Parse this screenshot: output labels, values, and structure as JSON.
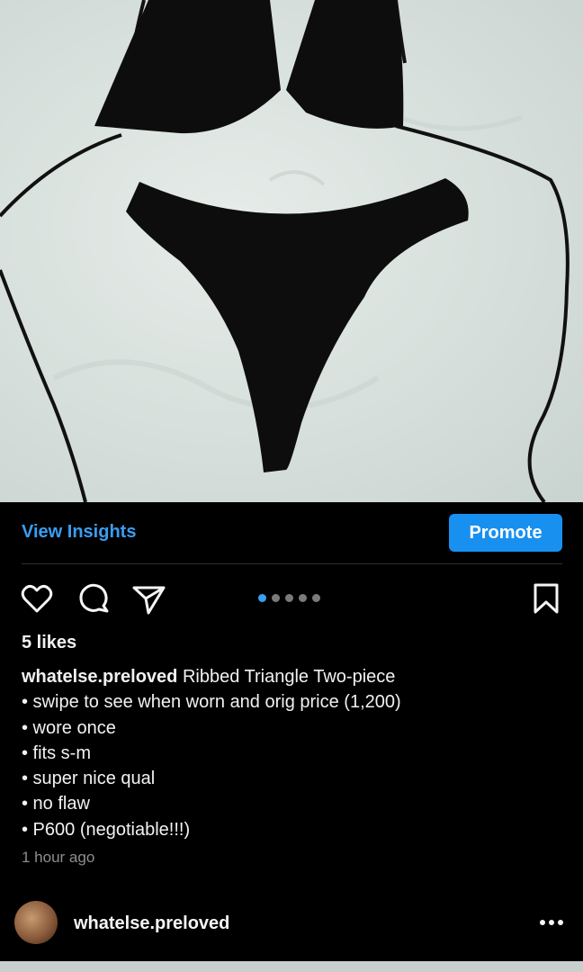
{
  "post": {
    "insights_label": "View Insights",
    "promote_label": "Promote",
    "carousel": {
      "count": 5,
      "active_index": 0
    },
    "likes": "5 likes",
    "username": "whatelse.preloved",
    "title": "Ribbed Triangle Two-piece",
    "caption_lines": [
      "• swipe to see when worn and orig price (1,200)",
      "• wore once",
      "• fits s-m",
      "• super nice qual",
      "• no flaw",
      "• P600 (negotiable!!!)"
    ],
    "time_ago": "1 hour ago"
  },
  "footer": {
    "username": "whatelse.preloved"
  },
  "icons": {
    "like": "heart-icon",
    "comment": "comment-icon",
    "share": "send-icon",
    "save": "bookmark-icon",
    "more": "more-horizontal-icon"
  },
  "colors": {
    "accent": "#3a9ef3",
    "promote_bg": "#1890f0",
    "background": "#000000",
    "muted_text": "#8e8e8e"
  }
}
